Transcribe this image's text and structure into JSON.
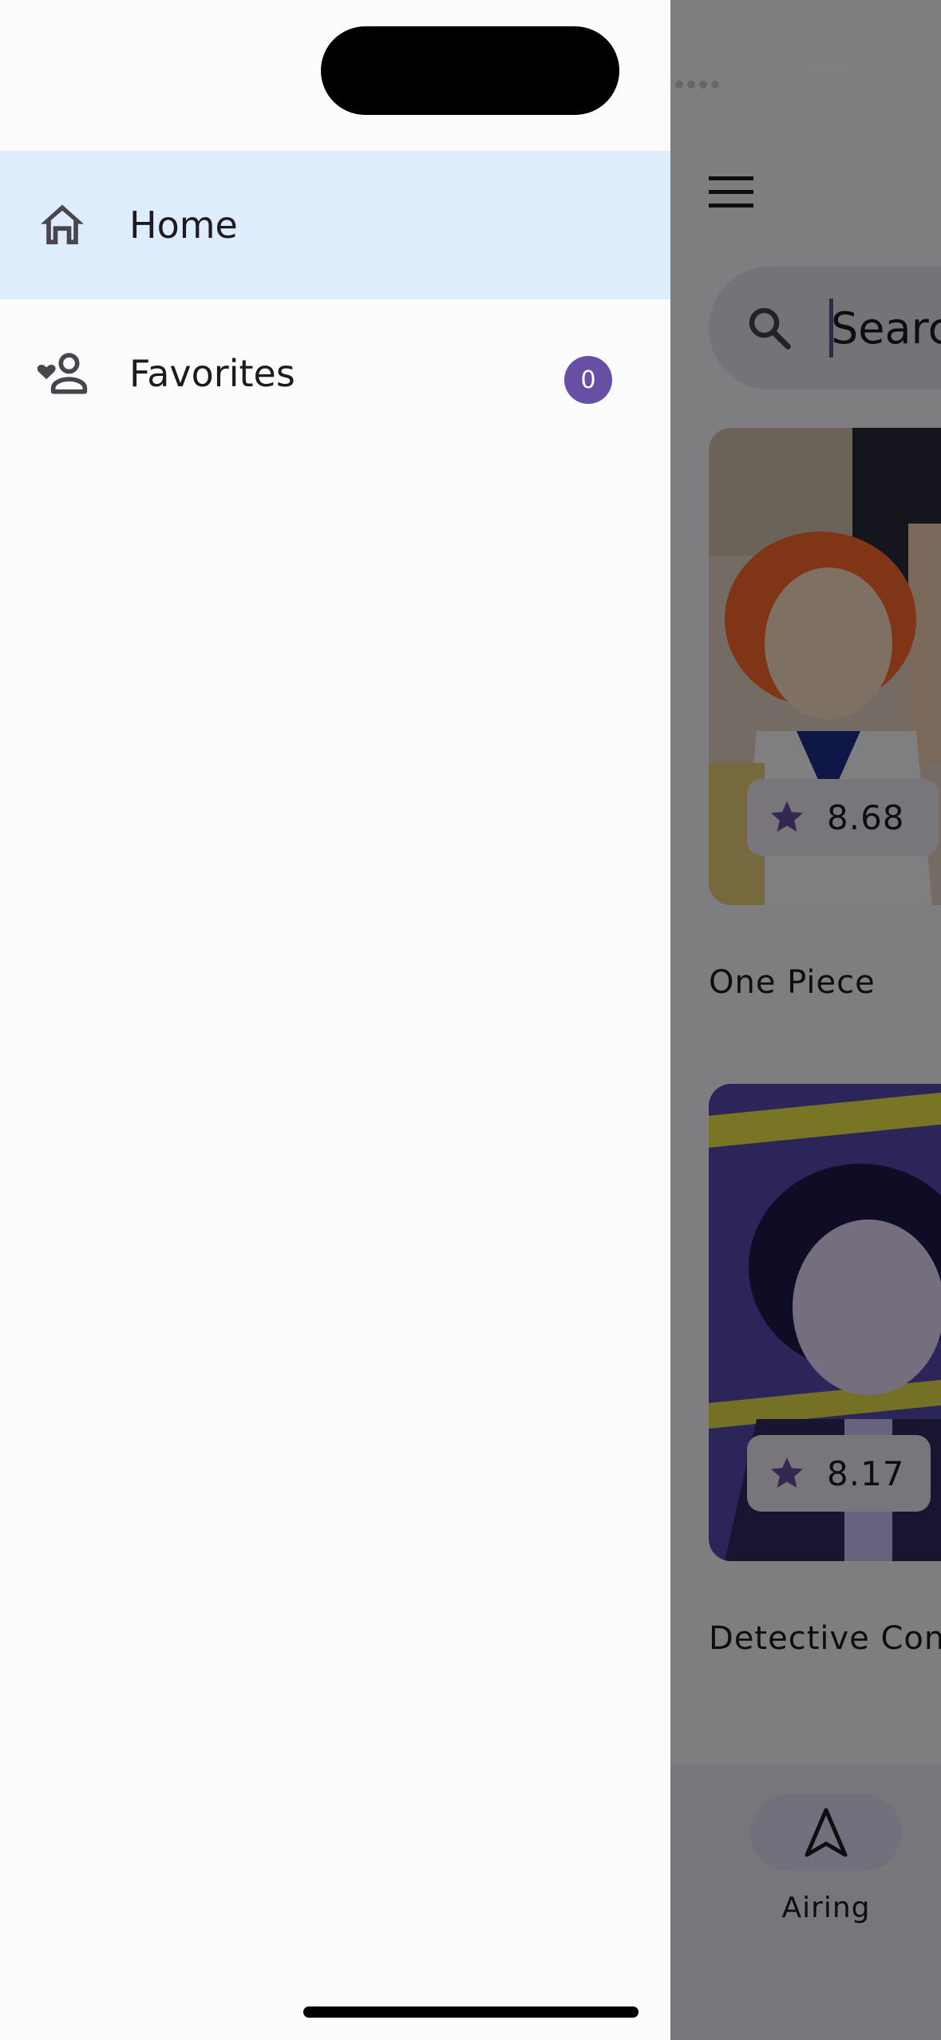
{
  "drawer": {
    "items": [
      {
        "label": "Home",
        "icon": "home-icon",
        "selected": true
      },
      {
        "label": "Favorites",
        "icon": "favorites-person-icon",
        "badge": "0"
      }
    ]
  },
  "app_bar": {
    "menu_icon": "hamburger-menu-icon"
  },
  "search": {
    "placeholder": "Search"
  },
  "anime_list": [
    {
      "title": "One Piece",
      "rating": "8.68"
    },
    {
      "title": "Detective Conan",
      "rating": "8.17"
    }
  ],
  "bottom_nav": {
    "items": [
      {
        "label": "Airing",
        "icon": "navigation-arrow-icon",
        "selected": true
      }
    ]
  },
  "colors": {
    "accent": "#6750a4",
    "drawer_selected_bg": "#deedfc",
    "scrim": "rgba(0,0,0,0.5)"
  }
}
